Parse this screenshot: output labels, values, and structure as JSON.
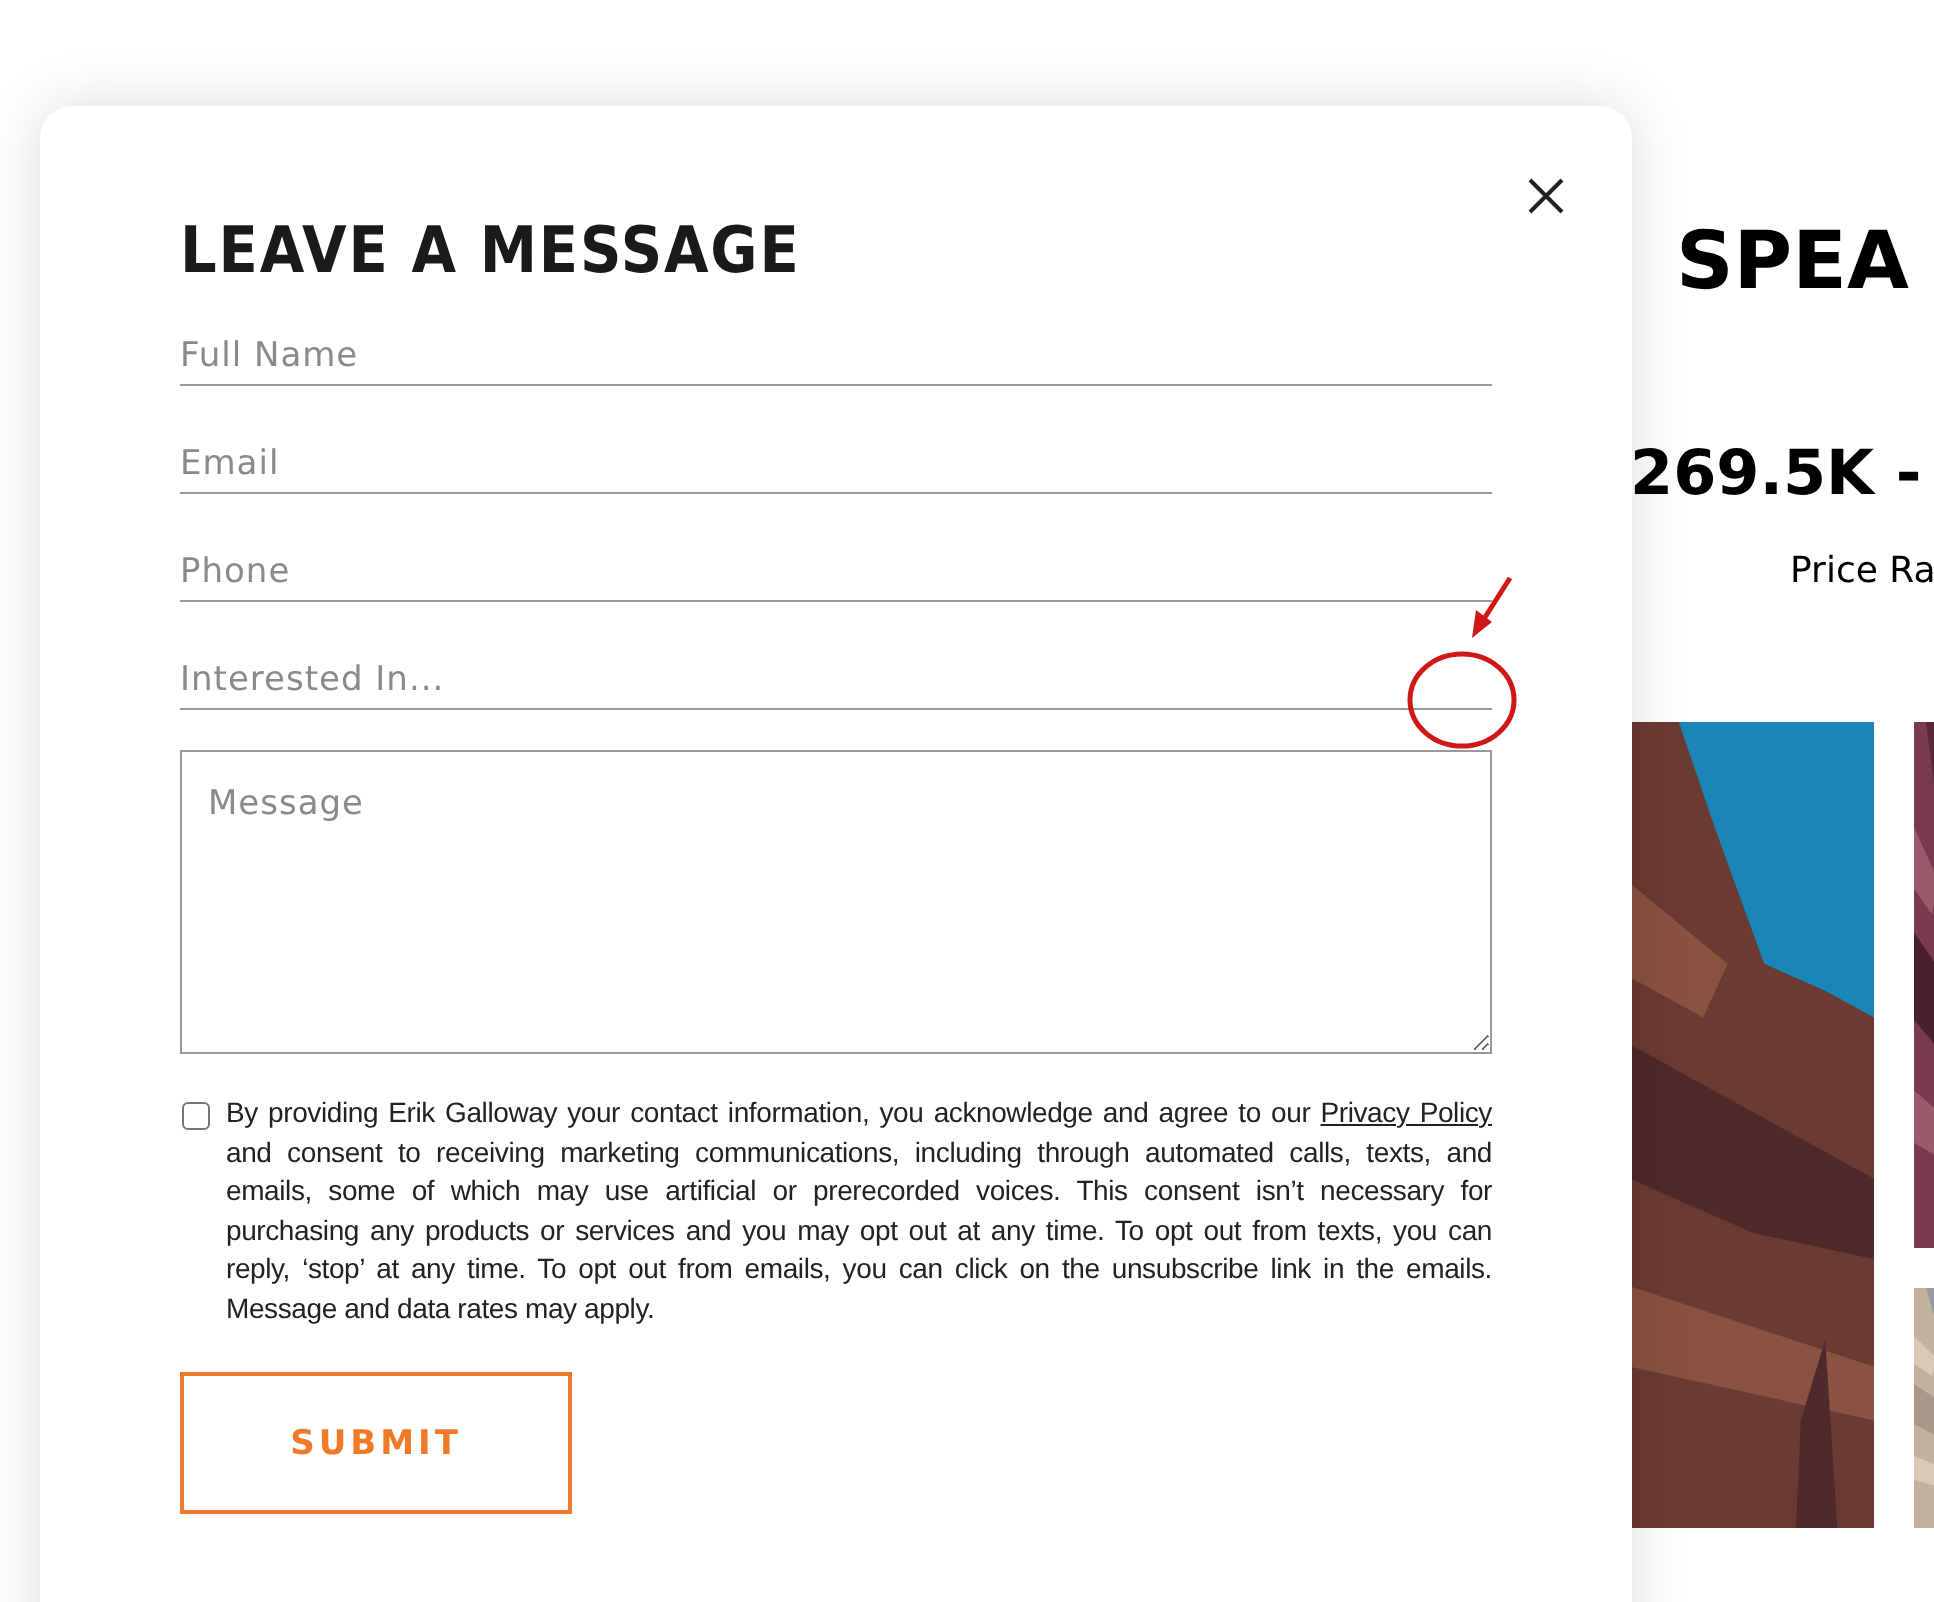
{
  "background": {
    "heading": "SPEA",
    "price": "269.5K -",
    "price_label": "Price Ra"
  },
  "modal": {
    "title": "LEAVE A MESSAGE",
    "fields": [
      {
        "placeholder": "Full Name"
      },
      {
        "placeholder": "Email"
      },
      {
        "placeholder": "Phone"
      },
      {
        "placeholder": "Interested In..."
      }
    ],
    "message": {
      "placeholder": "Message"
    },
    "consent": {
      "checked": false,
      "text_before": "By providing Erik Galloway your contact information, you acknowledge and agree to our ",
      "link": "Privacy Policy",
      "text_after": " and consent to receiving marketing communications, including through automated calls, texts, and emails, some of which may use artificial or prerecorded voices. This consent isn’t necessary for purchasing any products or services and you may opt out at any time. To opt out from texts, you can reply, ‘stop’ at any time. To opt out from emails, you can click on the unsubscribe link in the emails. Message and data rates may apply."
    },
    "submit": "SUBMIT"
  }
}
